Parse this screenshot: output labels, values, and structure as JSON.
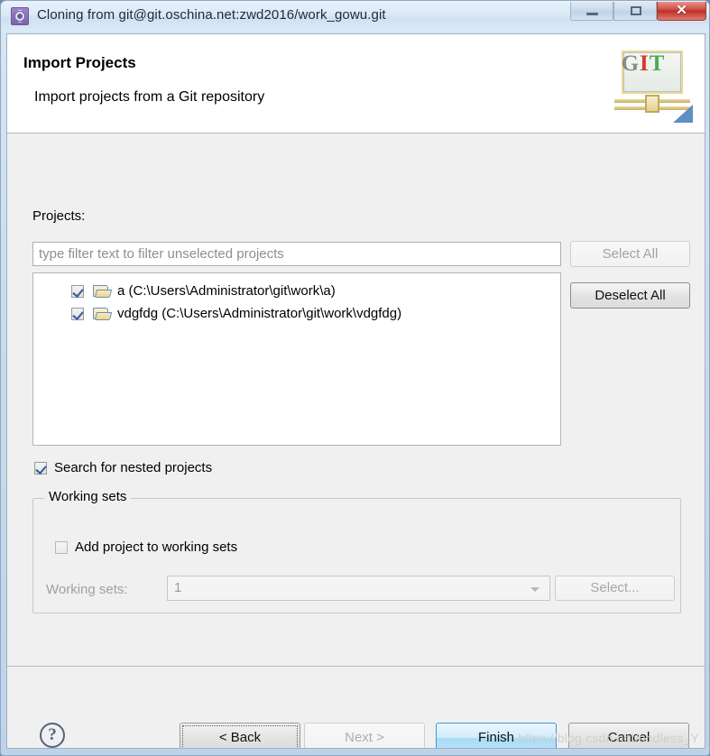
{
  "window": {
    "title": "Cloning from git@git.oschina.net:zwd2016/work_gowu.git",
    "icon": "gear-icon",
    "controls": {
      "minimize": "─",
      "maximize": "□",
      "close": "✕"
    }
  },
  "header": {
    "title": "Import Projects",
    "subtitle": "Import projects from a Git repository",
    "logo": {
      "g": "G",
      "i": "I",
      "t": "T",
      "g_color": "#8a8a8a",
      "i_color": "#d23a2e",
      "t_color": "#4cab52"
    }
  },
  "projects": {
    "label": "Projects:",
    "filter_placeholder": "type filter text to filter unselected projects",
    "filter_value": "",
    "items": [
      {
        "checked": true,
        "label": "a (C:\\Users\\Administrator\\git\\work\\a)"
      },
      {
        "checked": true,
        "label": "vdgfdg (C:\\Users\\Administrator\\git\\work\\vdgfdg)"
      }
    ],
    "select_all_label": "Select All",
    "select_all_enabled": false,
    "deselect_all_label": "Deselect All",
    "deselect_all_enabled": true
  },
  "nested": {
    "label": "Search for nested projects",
    "checked": true
  },
  "working_sets": {
    "group_label": "Working sets",
    "add_label": "Add project to working sets",
    "add_checked": false,
    "select_label": "Working sets:",
    "combo_value": "1",
    "select_button": "Select...",
    "enabled": false
  },
  "footer": {
    "help": "?",
    "back": "< Back",
    "next": "Next >",
    "finish": "Finish",
    "cancel": "Cancel",
    "back_focused": true,
    "next_enabled": false,
    "finish_default": true
  },
  "watermark": "https://blog.csdn.net/endless_Y"
}
